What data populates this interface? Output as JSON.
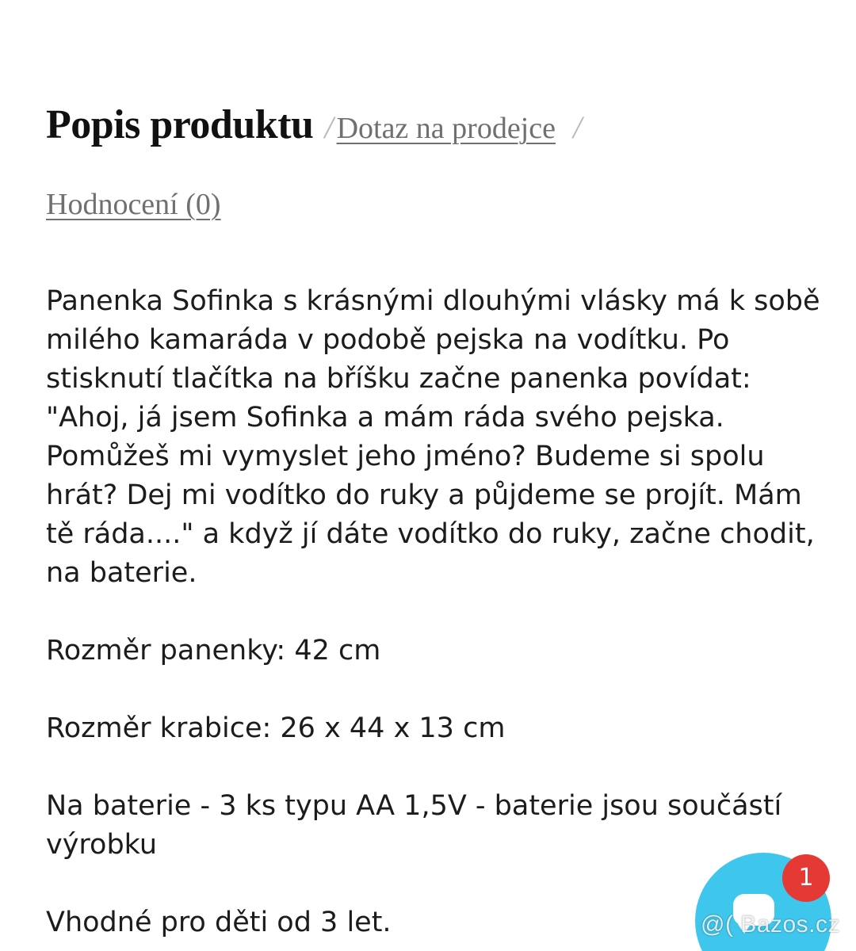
{
  "tabs": {
    "active": "Popis produktu",
    "separator": "/",
    "seller_question": "Dotaz na prodejce",
    "reviews": "Hodnocení (0)"
  },
  "description": {
    "paragraphs": [
      "Panenka Sofinka s krásnými dlouhými vlásky má k sobě milého kamaráda v podobě pejska na vodítku. Po stisknutí tlačítka na bříšku začne panenka povídat: \"Ahoj, já jsem Sofinka a mám ráda svého pejska. Pomůžeš mi vymyslet jeho jméno? Budeme si spolu hrát? Dej mi vodítko do ruky a půjdeme se projít. Mám tě ráda....\" a když jí dáte vodítko do ruky, začne chodit, na baterie.",
      "Rozměr panenky: 42 cm",
      "Rozměr krabice: 26 x 44 x 13 cm",
      "Na baterie - 3 ks typu AA 1,5V - baterie jsou součástí výrobku",
      "Vhodné pro děti od 3 let."
    ]
  },
  "chat": {
    "badge_count": "1",
    "icon": "chat-bubble-icon",
    "color": "#3ec6ec",
    "badge_color": "#e53935"
  },
  "watermark": "@( Bazos.cz"
}
